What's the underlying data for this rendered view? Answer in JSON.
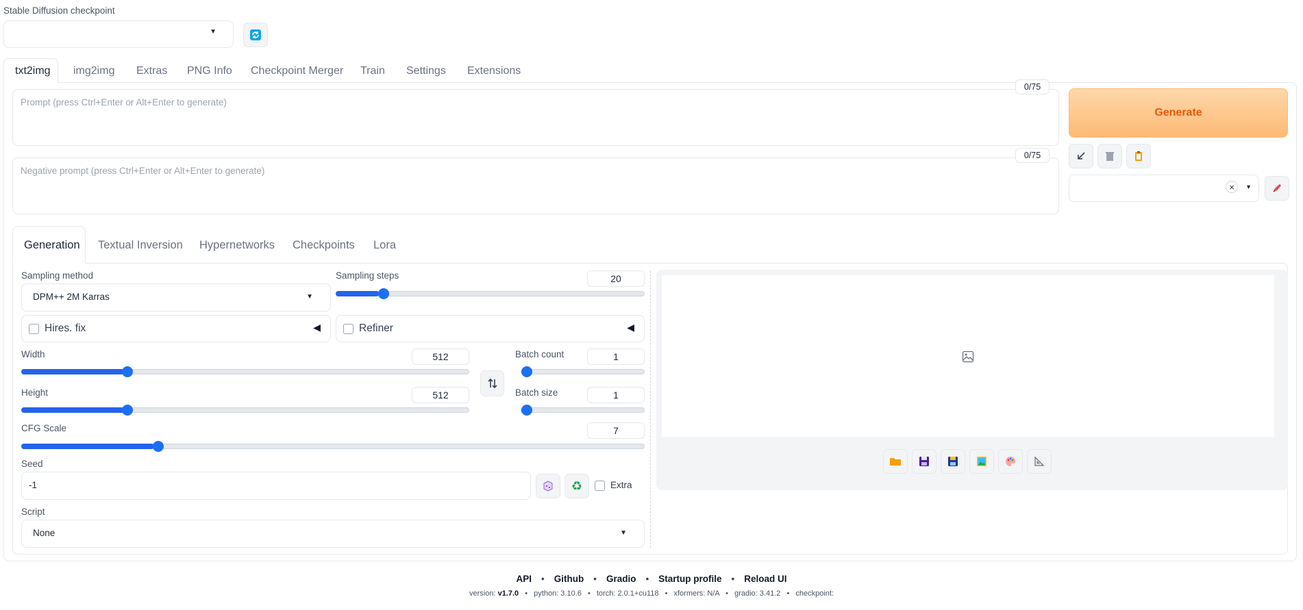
{
  "checkpoint": {
    "label": "Stable Diffusion checkpoint",
    "value": ""
  },
  "top_tabs": [
    "txt2img",
    "img2img",
    "Extras",
    "PNG Info",
    "Checkpoint Merger",
    "Train",
    "Settings",
    "Extensions"
  ],
  "prompt": {
    "placeholder": "Prompt (press Ctrl+Enter or Alt+Enter to generate)",
    "token_count": "0/75"
  },
  "negative_prompt": {
    "placeholder": "Negative prompt (press Ctrl+Enter or Alt+Enter to generate)",
    "token_count": "0/75"
  },
  "generate_label": "Generate",
  "styles": {
    "value": "",
    "clear_symbol": "×"
  },
  "sub_tabs": [
    "Generation",
    "Textual Inversion",
    "Hypernetworks",
    "Checkpoints",
    "Lora"
  ],
  "sampling_method": {
    "label": "Sampling method",
    "value": "DPM++ 2M Karras"
  },
  "sampling_steps": {
    "label": "Sampling steps",
    "value": "20",
    "fraction": 0.14
  },
  "hires_fix": {
    "label": "Hires. fix"
  },
  "refiner": {
    "label": "Refiner"
  },
  "width": {
    "label": "Width",
    "value": "512",
    "fraction": 0.23
  },
  "height": {
    "label": "Height",
    "value": "512",
    "fraction": 0.23
  },
  "batch_count": {
    "label": "Batch count",
    "value": "1",
    "fraction": 0.0
  },
  "batch_size": {
    "label": "Batch size",
    "value": "1",
    "fraction": 0.0
  },
  "cfg_scale": {
    "label": "CFG Scale",
    "value": "7",
    "fraction": 0.214
  },
  "seed": {
    "label": "Seed",
    "value": "-1",
    "extra_label": "Extra"
  },
  "script": {
    "label": "Script",
    "value": "None"
  },
  "footer": {
    "links": [
      "API",
      "Github",
      "Gradio",
      "Startup profile",
      "Reload UI"
    ],
    "separator": "•",
    "version_label": "version:",
    "version_value": "v1.7.0",
    "python": "python: 3.10.6",
    "torch": "torch: 2.0.1+cu118",
    "xformers": "xformers: N/A",
    "gradio": "gradio: 3.41.2",
    "checkpoint": "checkpoint:"
  },
  "colors": {
    "accent": "#1d6ff2",
    "generate_text": "#e8590c",
    "generate_bg_from": "#fed7aa",
    "generate_bg_to": "#fdba74"
  }
}
